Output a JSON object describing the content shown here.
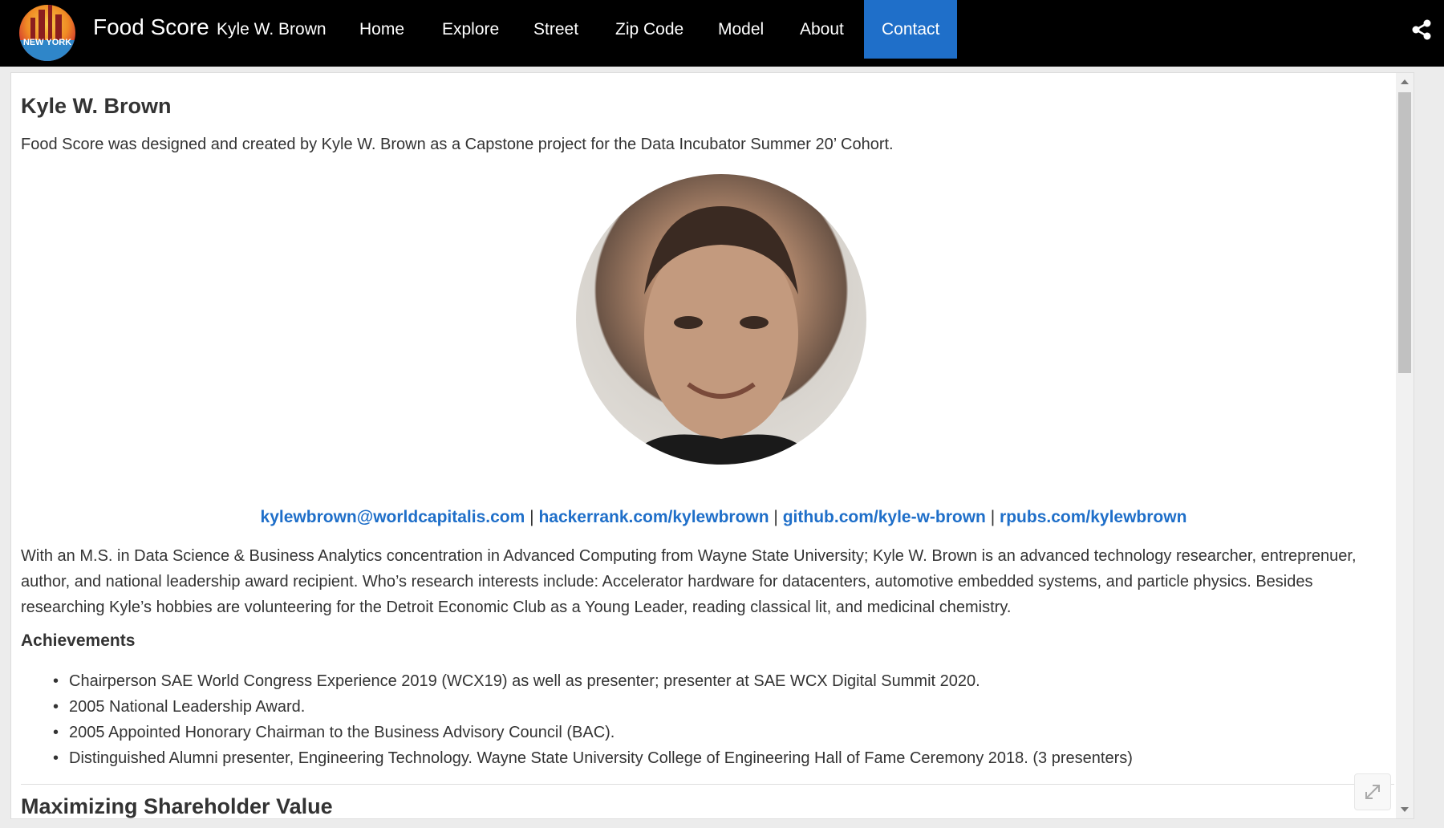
{
  "nav": {
    "logo_text": "NEW YORK",
    "brand": "Food Score",
    "subtitle": "Kyle W. Brown",
    "items": [
      {
        "label": "Home"
      },
      {
        "label": "Explore"
      },
      {
        "label": "Street"
      },
      {
        "label": "Zip Code"
      },
      {
        "label": "Model"
      },
      {
        "label": "About"
      },
      {
        "label": "Contact",
        "active": true
      }
    ],
    "share_icon": "share-icon"
  },
  "content": {
    "heading": "Kyle W. Brown",
    "lead": "Food Score was designed and created by Kyle W. Brown as a Capstone project for the Data Incubator Summer 20’ Cohort.",
    "links": [
      "kylewbrown@worldcapitalis.com",
      "hackerrank.com/kylewbrown",
      "github.com/kyle-w-brown",
      "rpubs.com/kylewbrown"
    ],
    "separator": "|",
    "bio": "With an M.S. in Data Science & Business Analytics concentration in Advanced Computing from Wayne State University; Kyle W. Brown is an advanced technology researcher, entreprenuer, author, and national leadership award recipient. Who’s research interests include: Accelerator hardware for datacenters, automotive embedded systems, and particle physics. Besides researching Kyle’s hobbies are volunteering for the Detroit Economic Club as a Young Leader, reading classical lit, and medicinal chemistry.",
    "achievements_heading": "Achievements",
    "achievements": [
      "Chairperson SAE World Congress Experience 2019 (WCX19) as well as presenter; presenter at SAE WCX Digital Summit 2020.",
      "2005 National Leadership Award.",
      "2005 Appointed Honorary Chairman to the Business Advisory Council (BAC).",
      "Distinguished Alumni presenter, Engineering Technology. Wayne State University College of Engineering Hall of Fame Ceremony 2018. (3 presenters)"
    ],
    "next_heading": "Maximizing Shareholder Value"
  },
  "colors": {
    "navbar": "#000000",
    "active_tab": "#1f6fc9",
    "link": "#1f6fc9"
  }
}
